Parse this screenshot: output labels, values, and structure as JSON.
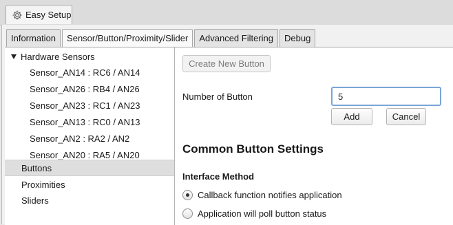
{
  "app_tab": {
    "label": "Easy Setup",
    "icon": "gear-icon"
  },
  "tabs": [
    {
      "label": "Information",
      "active": false
    },
    {
      "label": "Sensor/Button/Proximity/Slider",
      "active": true
    },
    {
      "label": "Advanced Filtering",
      "active": false
    },
    {
      "label": "Debug",
      "active": false
    }
  ],
  "tree": {
    "hardware_sensors": {
      "label": "Hardware Sensors",
      "expanded": true,
      "children": [
        "Sensor_AN14 : RC6 / AN14",
        "Sensor_AN26 : RB4 / AN26",
        "Sensor_AN23 : RC1 / AN23",
        "Sensor_AN13 : RC0 / AN13",
        "Sensor_AN2 : RA2 / AN2",
        "Sensor_AN20 : RA5 / AN20"
      ]
    },
    "buttons": {
      "label": "Buttons",
      "selected": true
    },
    "proximities": {
      "label": "Proximities"
    },
    "sliders": {
      "label": "Sliders"
    }
  },
  "form": {
    "create_button": "Create New Button",
    "number_label": "Number of Button",
    "number_value": "5",
    "add_button": "Add",
    "cancel_button": "Cancel",
    "section_title": "Common Button Settings",
    "interface_title": "Interface Method",
    "options": [
      {
        "label": "Callback function notifies application",
        "checked": true
      },
      {
        "label": "Application will poll button status",
        "checked": false
      }
    ]
  }
}
